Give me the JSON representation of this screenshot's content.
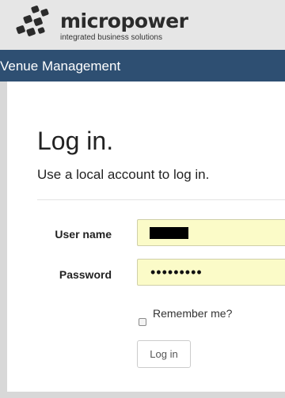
{
  "header": {
    "brand": "micropower",
    "tagline": "integrated business solutions"
  },
  "navbar": {
    "title": "Venue Management"
  },
  "page": {
    "title": "Log in.",
    "subtitle": "Use a local account to log in."
  },
  "form": {
    "username_label": "User name",
    "password_label": "Password",
    "password_value": "•••••••••",
    "remember_label": "Remember me?",
    "submit_label": "Log in"
  },
  "colors": {
    "navbar": "#2e4f72",
    "header": "#e6e6e6",
    "field_bg": "#fbfbc8"
  }
}
